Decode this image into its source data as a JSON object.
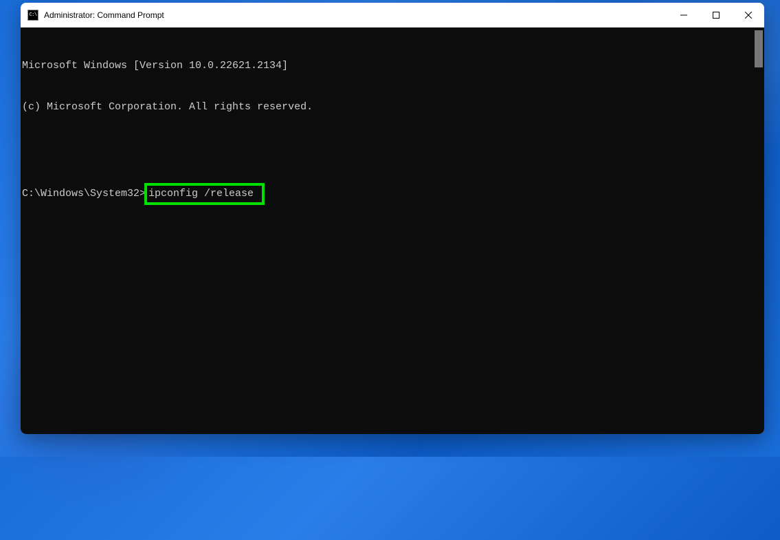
{
  "window": {
    "title": "Administrator: Command Prompt",
    "icon_label": "C:\\"
  },
  "terminal": {
    "header_line1": "Microsoft Windows [Version 10.0.22621.2134]",
    "header_line2": "(c) Microsoft Corporation. All rights reserved.",
    "prompt": "C:\\Windows\\System32>",
    "command": "ipconfig /release"
  }
}
